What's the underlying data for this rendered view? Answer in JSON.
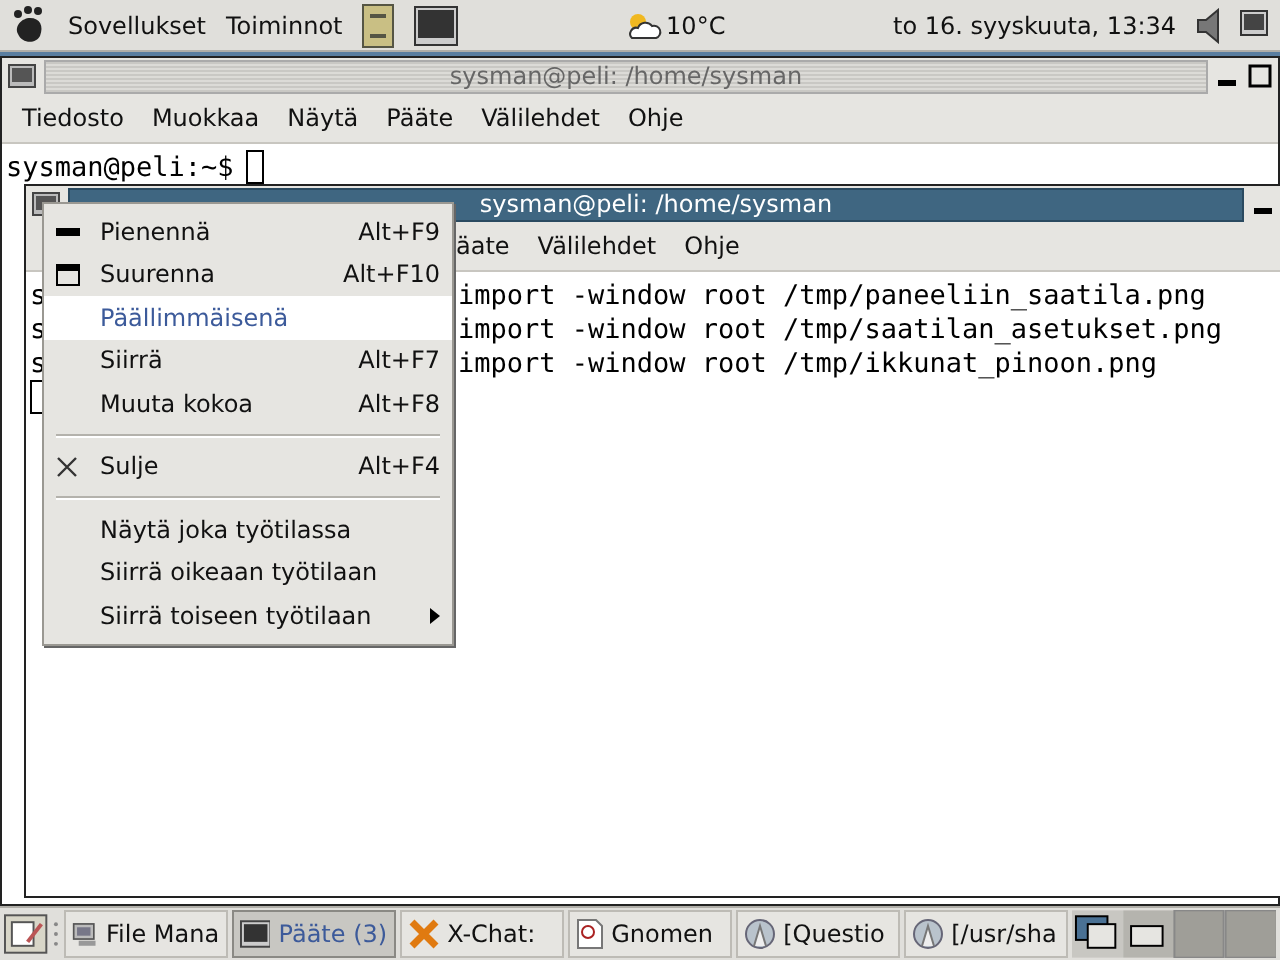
{
  "top_panel": {
    "menus": [
      "Sovellukset",
      "Toiminnot"
    ],
    "weather": "10°C",
    "clock": "to 16. syyskuuta, 13:34"
  },
  "back_window": {
    "title": "sysman@peli: /home/sysman",
    "menu": [
      "Tiedosto",
      "Muokkaa",
      "Näytä",
      "Pääte",
      "Välilehdet",
      "Ohje"
    ],
    "prompt": "sysman@peli:~$"
  },
  "front_window": {
    "title": "sysman@peli: /home/sysman",
    "menu": [
      "äate",
      "Välilehdet",
      "Ohje"
    ],
    "lines": [
      {
        "left": "s",
        "right": "import -window root /tmp/paneeliin_saatila.png"
      },
      {
        "left": "s",
        "right": "import -window root /tmp/saatilan_asetukset.png"
      },
      {
        "left": "s",
        "right": "import -window root /tmp/ikkunat_pinoon.png"
      }
    ]
  },
  "window_menu": {
    "items": [
      {
        "kind": "minimize",
        "label": "Pienennä",
        "shortcut": "Alt+F9",
        "selected": false,
        "submenu": false
      },
      {
        "kind": "maximize",
        "label": "Suurenna",
        "shortcut": "Alt+F10",
        "selected": false,
        "submenu": false
      },
      {
        "kind": "plain",
        "label": "Päällimmäisenä",
        "selected": true,
        "submenu": false
      },
      {
        "kind": "plain",
        "label": "Siirrä",
        "shortcut": "Alt+F7",
        "selected": false,
        "submenu": false
      },
      {
        "kind": "plain",
        "label": "Muuta kokoa",
        "shortcut": "Alt+F8",
        "selected": false,
        "submenu": false
      },
      {
        "kind": "separator"
      },
      {
        "kind": "close",
        "label": "Sulje",
        "shortcut": "Alt+F4",
        "selected": false,
        "submenu": false
      },
      {
        "kind": "separator"
      },
      {
        "kind": "plain",
        "label": "Näytä joka työtilassa",
        "selected": false,
        "submenu": false
      },
      {
        "kind": "plain",
        "label": "Siirrä oikeaan työtilaan",
        "selected": false,
        "submenu": false
      },
      {
        "kind": "plain",
        "label": "Siirrä toiseen työtilaan",
        "selected": false,
        "submenu": true
      }
    ]
  },
  "taskbar": {
    "tasks": [
      {
        "kind": "files",
        "label": "File Mana",
        "selected": false
      },
      {
        "kind": "terminal",
        "label": "Pääte (3)",
        "selected": true
      },
      {
        "kind": "chat",
        "label": "X-Chat:",
        "selected": false
      },
      {
        "kind": "document",
        "label": "Gnomen",
        "selected": false
      },
      {
        "kind": "browser",
        "label": "[Questio",
        "selected": false
      },
      {
        "kind": "browser",
        "label": "[/usr/sha",
        "selected": false
      }
    ]
  }
}
